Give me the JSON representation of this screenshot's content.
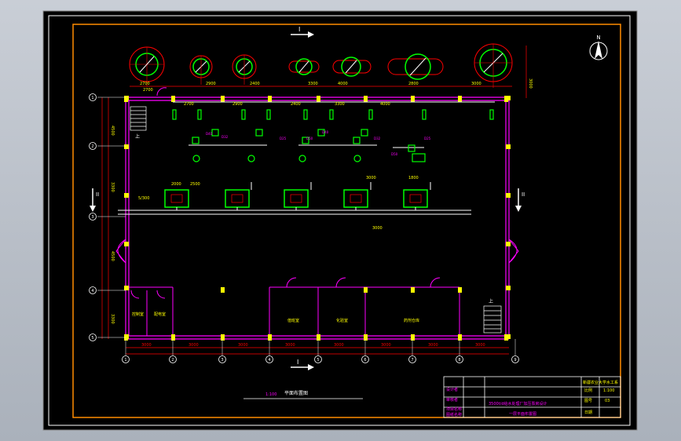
{
  "colors": {
    "background": "#000000",
    "frame": "#ff8c00",
    "wall": "#ff00ff",
    "column": "#ffff00",
    "dimension": "#ff0000",
    "equipment": "#00ff00",
    "pipe": "#ffffff",
    "text": "#ffff00",
    "title_block": "#ffffff"
  },
  "north_arrow": {
    "letter": "N",
    "icon": "north-arrow-icon"
  },
  "section_marks": {
    "top": "I",
    "bottom": "I",
    "left": "II",
    "right": "II"
  },
  "grid_rows": [
    "1",
    "2",
    "3",
    "4",
    "5"
  ],
  "grid_cols": [
    "1",
    "2",
    "3",
    "4",
    "5",
    "6",
    "7",
    "8",
    "9"
  ],
  "top_dims": [
    "2700",
    "2900",
    "2400",
    "3300",
    "4000",
    "2800",
    "3000"
  ],
  "bottom_dims": [
    "3000",
    "3000",
    "3000",
    "3000",
    "3000",
    "3000",
    "3000",
    "3000"
  ],
  "side_dims": [
    "4500",
    "3300",
    "4500",
    "3300"
  ],
  "misc_dims": [
    "2700",
    "2000",
    "2500",
    "3000",
    "1800",
    "5/300",
    "3000"
  ],
  "pipe_labels": [
    "D40",
    "D32",
    "D25",
    "D50",
    "D40",
    "D32",
    "D25",
    "D50"
  ],
  "rooms": [
    "控制室",
    "配电室",
    "值班室",
    "化验室",
    "药剂仓库"
  ],
  "stair_label": "上",
  "drawing_caption": "平面布置图",
  "scale_caption": "1:100",
  "title_block": {
    "row1_right": "新疆农业大学水工系",
    "labels": [
      "设计者",
      "审核者",
      "项目名称",
      "图纸名称"
    ],
    "project": "3500t/d给水处理厂加压泵房设计",
    "drawing": "一层平面布置图",
    "scale_label": "比例",
    "scale_value": "1:100",
    "sheet_label": "图号",
    "sheet_value": "03",
    "date_label": "日期"
  }
}
